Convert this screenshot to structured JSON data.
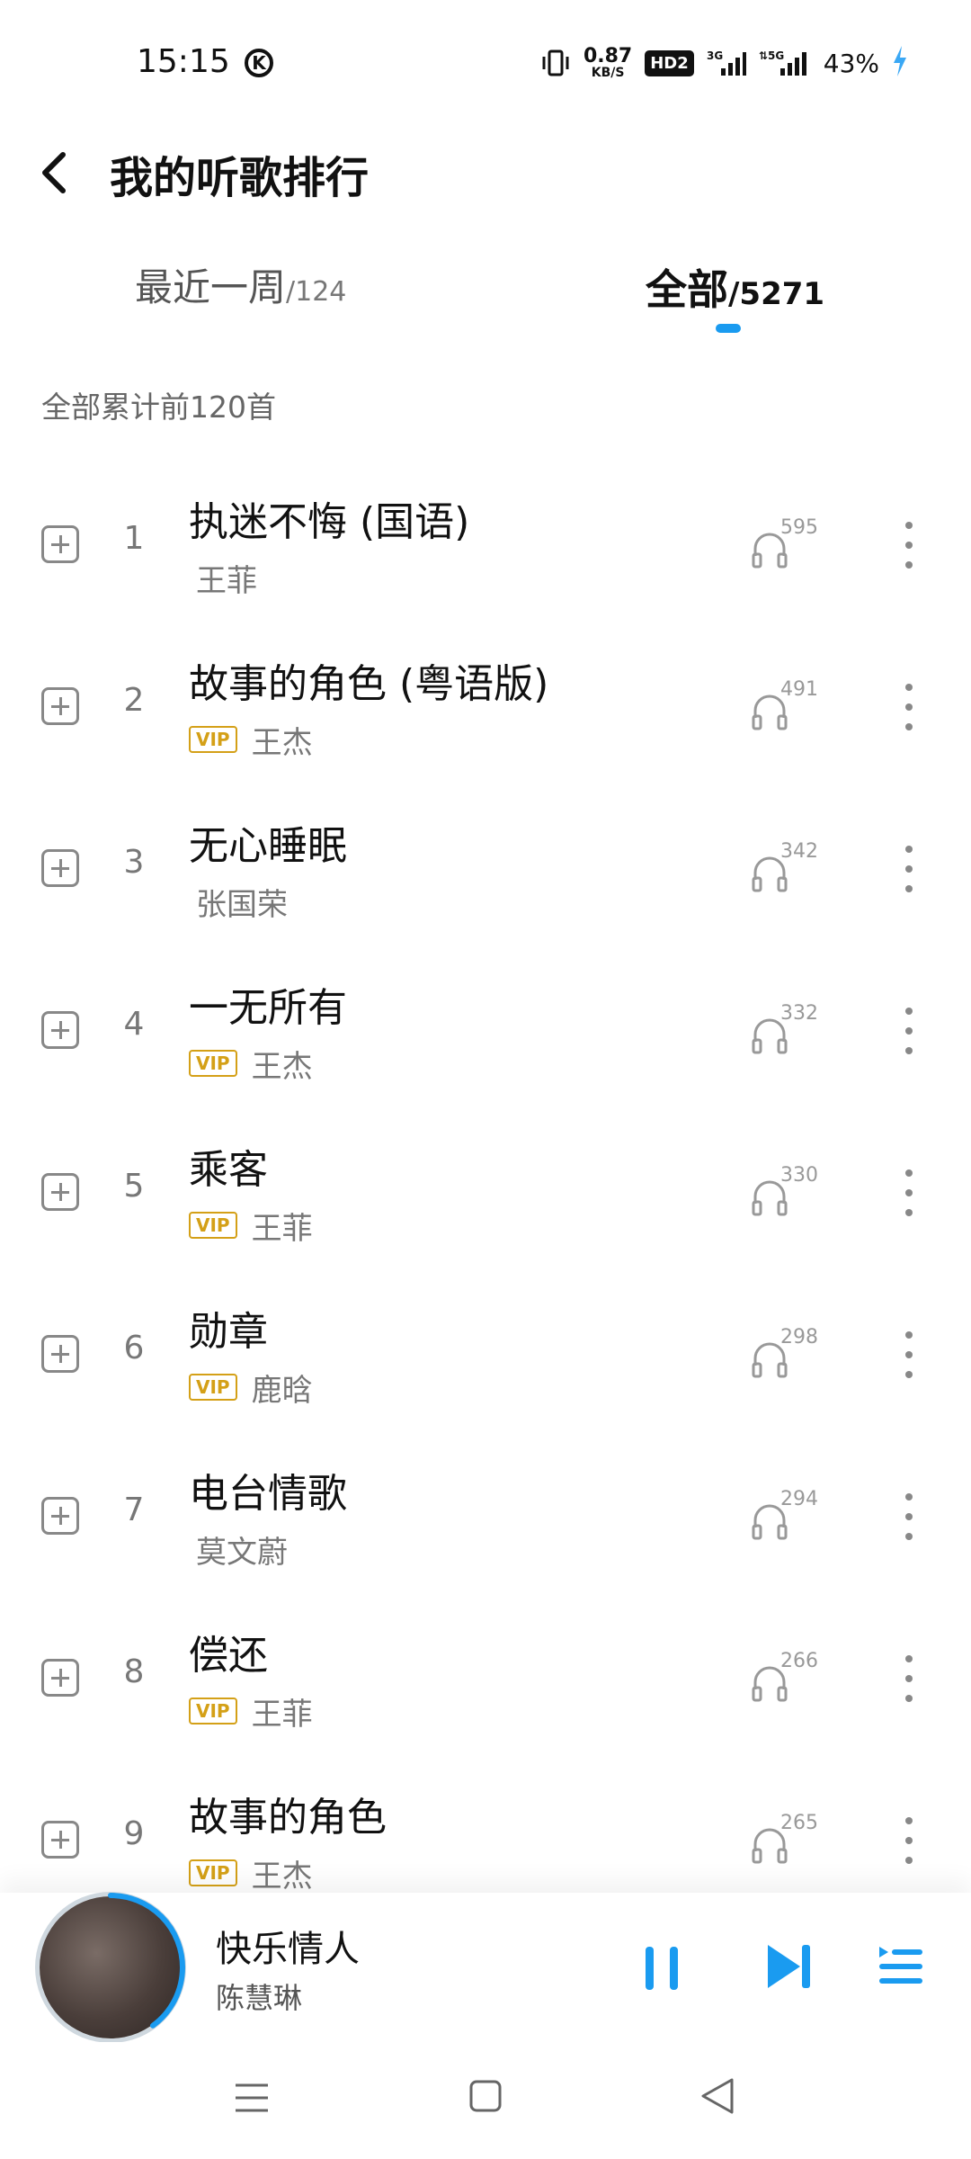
{
  "status_bar": {
    "time": "15:15",
    "k_icon": "K",
    "net_speed": "0.87",
    "net_unit": "KB/S",
    "hd_badge": "HD2",
    "battery": "43%"
  },
  "header": {
    "title": "我的听歌排行"
  },
  "tabs": [
    {
      "name": "最近一周",
      "count": "/124",
      "active": false
    },
    {
      "name": "全部",
      "count": "/5271",
      "active": true
    }
  ],
  "section_label": "全部累计前120首",
  "colors": {
    "accent": "#1a9bf0",
    "vip": "#d4a017"
  },
  "songs": [
    {
      "rank": "1",
      "title": "执迷不悔 (国语)",
      "artist": "王菲",
      "vip": false,
      "plays": "595"
    },
    {
      "rank": "2",
      "title": "故事的角色 (粤语版)",
      "artist": "王杰",
      "vip": true,
      "plays": "491"
    },
    {
      "rank": "3",
      "title": "无心睡眠",
      "artist": "张国荣",
      "vip": false,
      "plays": "342"
    },
    {
      "rank": "4",
      "title": "一无所有",
      "artist": "王杰",
      "vip": true,
      "plays": "332"
    },
    {
      "rank": "5",
      "title": "乘客",
      "artist": "王菲",
      "vip": true,
      "plays": "330"
    },
    {
      "rank": "6",
      "title": "勋章",
      "artist": "鹿晗",
      "vip": true,
      "plays": "298"
    },
    {
      "rank": "7",
      "title": "电台情歌",
      "artist": "莫文蔚",
      "vip": false,
      "plays": "294"
    },
    {
      "rank": "8",
      "title": "偿还",
      "artist": "王菲",
      "vip": true,
      "plays": "266"
    },
    {
      "rank": "9",
      "title": "故事的角色",
      "artist": "王杰",
      "vip": true,
      "plays": "265"
    }
  ],
  "vip_label": "VIP",
  "player": {
    "title": "快乐情人",
    "artist": "陈慧琳",
    "progress": 0.4
  }
}
